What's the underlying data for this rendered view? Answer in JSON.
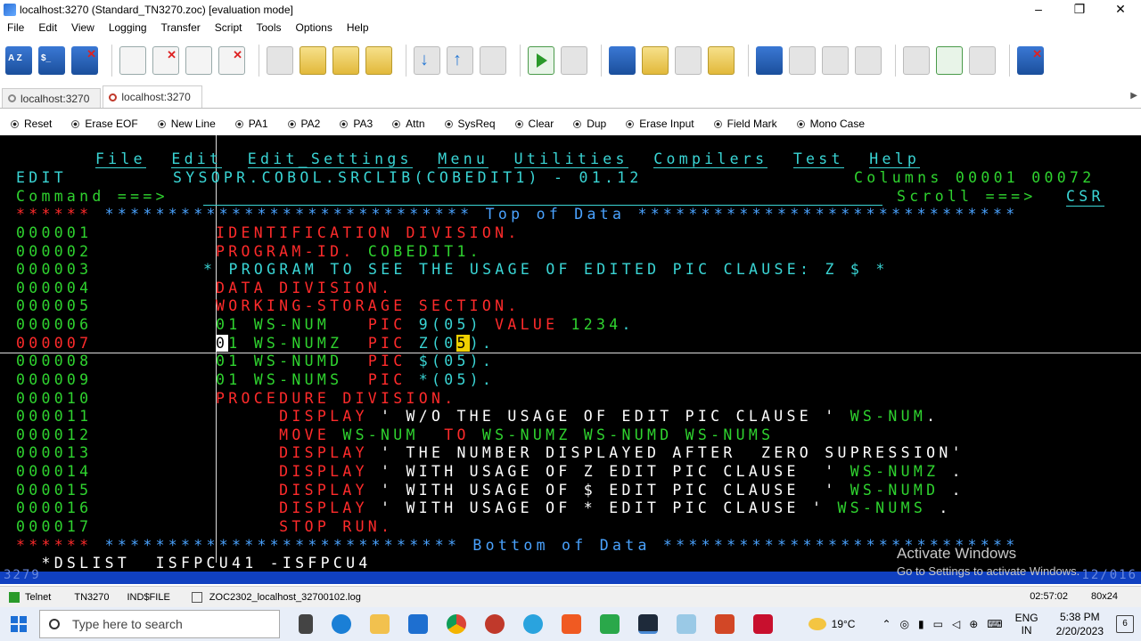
{
  "window": {
    "title": "localhost:3270 (Standard_TN3270.zoc) [evaluation mode]",
    "controls": [
      "–",
      "❐",
      "✕"
    ]
  },
  "menu": [
    "File",
    "Edit",
    "View",
    "Logging",
    "Transfer",
    "Script",
    "Tools",
    "Options",
    "Help"
  ],
  "tabs": [
    {
      "label": "localhost:3270",
      "active": false
    },
    {
      "label": "localhost:3270",
      "active": true
    }
  ],
  "buttons": [
    "Reset",
    "Erase EOF",
    "New Line",
    "PA1",
    "PA2",
    "PA3",
    "Attn",
    "SysReq",
    "Clear",
    "Dup",
    "Erase Input",
    "Field Mark",
    "Mono Case"
  ],
  "terminal": {
    "menu": [
      "File",
      "Edit",
      "Edit_Settings",
      "Menu",
      "Utilities",
      "Compilers",
      "Test",
      "Help"
    ],
    "header_left": "EDIT",
    "dataset": "SYSOPR.COBOL.SRCLIB(COBEDIT1) - 01.12",
    "columns": "Columns 00001 00072",
    "command_label": "Command ===>",
    "scroll_label": "Scroll ===>",
    "scroll_value": "CSR",
    "top_marker_stars": "******",
    "top_marker": " ***************************** Top of Data ******************************",
    "bottom_marker": " **************************** Bottom of Data ****************************",
    "lines": [
      {
        "num": "000001",
        "code": "IDENTIFICATION DIVISION."
      },
      {
        "num": "000002",
        "code": "PROGRAM-ID. COBEDIT1."
      },
      {
        "num": "000003",
        "code": "* PROGRAM TO SEE THE USAGE OF EDITED PIC CLAUSE: Z $ *"
      },
      {
        "num": "000004",
        "code": "DATA DIVISION."
      },
      {
        "num": "000005",
        "code": "WORKING-STORAGE SECTION."
      },
      {
        "num": "000006",
        "code": "01 WS-NUM   PIC 9(05) VALUE 1234."
      },
      {
        "num": "000007",
        "code": "01 WS-NUMZ  PIC Z(05)."
      },
      {
        "num": "000008",
        "code": "01 WS-NUMD  PIC $(05)."
      },
      {
        "num": "000009",
        "code": "01 WS-NUMS  PIC *(05)."
      },
      {
        "num": "000010",
        "code": "PROCEDURE DIVISION."
      },
      {
        "num": "000011",
        "code": "     DISPLAY ' W/O THE USAGE OF EDIT PIC CLAUSE ' WS-NUM."
      },
      {
        "num": "000012",
        "code": "     MOVE WS-NUM  TO WS-NUMZ WS-NUMD WS-NUMS"
      },
      {
        "num": "000013",
        "code": "     DISPLAY ' THE NUMBER DISPLAYED AFTER  ZERO SUPRESSION'"
      },
      {
        "num": "000014",
        "code": "     DISPLAY ' WITH USAGE OF Z EDIT PIC CLAUSE  ' WS-NUMZ ."
      },
      {
        "num": "000015",
        "code": "     DISPLAY ' WITH USAGE OF $ EDIT PIC CLAUSE  ' WS-NUMD ."
      },
      {
        "num": "000016",
        "code": "     DISPLAY ' WITH USAGE OF * EDIT PIC CLAUSE ' WS-NUMS ."
      },
      {
        "num": "000017",
        "code": "     STOP RUN."
      }
    ],
    "dslist_line": "  *DSLIST  ISFPCU41 -ISFPCU4",
    "status_left": "3279",
    "status_right": "12/016"
  },
  "watermark": {
    "line1": "Activate Windows",
    "line2": "Go to Settings to activate Windows."
  },
  "statusbar": {
    "protocol": "Telnet",
    "emulation": "TN3270",
    "file": "IND$FILE",
    "log": "ZOC2302_localhost_32700102.log",
    "time": "02:57:02",
    "size": "80x24"
  },
  "taskbar": {
    "search_placeholder": "Type here to search",
    "temperature": "19°C",
    "lang1": "ENG",
    "lang2": "IN",
    "time": "5:38 PM",
    "date": "2/20/2023",
    "notifications": "6"
  }
}
